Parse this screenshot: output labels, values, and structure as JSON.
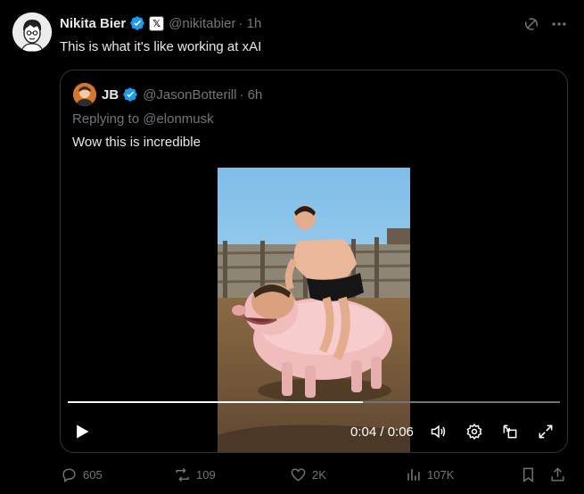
{
  "author": {
    "name": "Nikita Bier",
    "handle": "@nikitabier",
    "time": "· 1h",
    "affiliation_badge": "𝕏",
    "verified_color": "#1d9bf0"
  },
  "tweet": {
    "text": "This is what it's like working at xAI"
  },
  "quote": {
    "author_name": "JB",
    "handle": "@JasonBotterill",
    "time": "· 6h",
    "replying_prefix": "Replying to ",
    "replying_to": "@elonmusk",
    "text": "Wow this is incredible"
  },
  "video": {
    "time_display": "0:04 / 0:06",
    "progress": 0.6
  },
  "actions": {
    "replies": "605",
    "reposts": "109",
    "likes": "2K",
    "views": "107K"
  },
  "icons": {
    "grok": "grok-icon",
    "more": "more-icon",
    "reply": "reply-icon",
    "repost": "repost-icon",
    "like": "like-icon",
    "views": "views-icon",
    "bookmark": "bookmark-icon",
    "share": "share-icon",
    "play": "play-icon",
    "volume": "volume-icon",
    "settings": "settings-icon",
    "pip": "picture-in-picture-icon",
    "fullscreen": "fullscreen-icon"
  },
  "colors": {
    "accent": "#1d9bf0",
    "muted": "#71767b",
    "border": "#2f3336",
    "background": "#000000"
  }
}
